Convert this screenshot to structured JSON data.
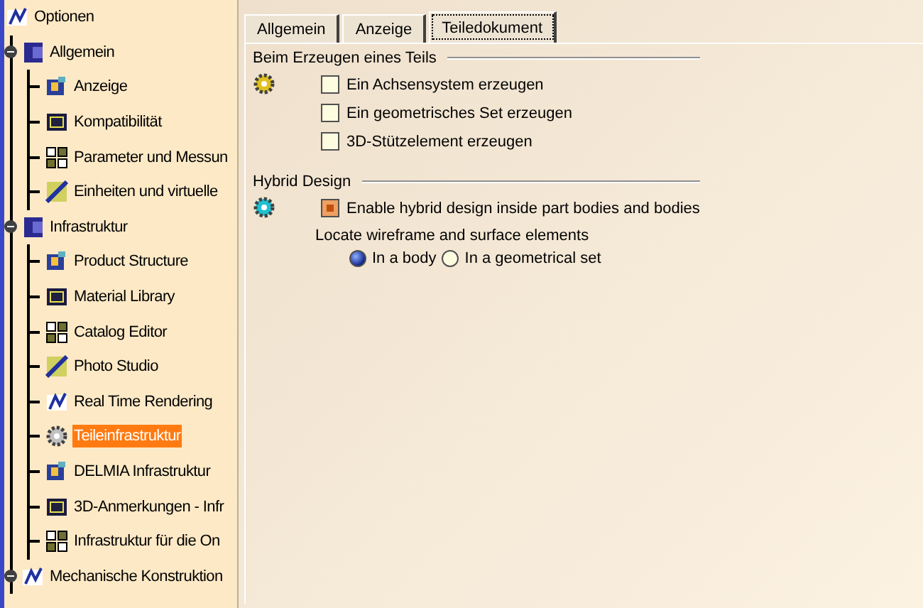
{
  "tree": {
    "label": "Optionen",
    "children": [
      {
        "label": "Allgemein",
        "expanded": true,
        "selected": false,
        "children": [
          {
            "label": "Anzeige",
            "selected": false
          },
          {
            "label": "Kompatibilität",
            "selected": false
          },
          {
            "label": "Parameter und Messun",
            "selected": false
          },
          {
            "label": "Einheiten und virtuelle",
            "selected": false
          }
        ]
      },
      {
        "label": "Infrastruktur",
        "expanded": true,
        "selected": false,
        "children": [
          {
            "label": "Product Structure",
            "selected": false
          },
          {
            "label": "Material Library",
            "selected": false
          },
          {
            "label": "Catalog Editor",
            "selected": false
          },
          {
            "label": "Photo Studio",
            "selected": false
          },
          {
            "label": "Real Time Rendering",
            "selected": false
          },
          {
            "label": "Teileinfrastruktur",
            "selected": true
          },
          {
            "label": "DELMIA Infrastruktur",
            "selected": false
          },
          {
            "label": "3D-Anmerkungen - Infr",
            "selected": false
          },
          {
            "label": "Infrastruktur für die On",
            "selected": false
          }
        ]
      },
      {
        "label": "Mechanische Konstruktion",
        "expanded": true,
        "selected": false
      }
    ]
  },
  "tabs": [
    {
      "label": "Allgemein",
      "selected": false
    },
    {
      "label": "Anzeige",
      "selected": false
    },
    {
      "label": "Teiledokument",
      "selected": true
    }
  ],
  "groups": [
    {
      "title": "Beim Erzeugen eines Teils",
      "options": [
        {
          "kind": "checkbox",
          "label": "Ein Achsensystem erzeugen",
          "checked": false
        },
        {
          "kind": "checkbox",
          "label": "Ein geometrisches Set erzeugen",
          "checked": false
        },
        {
          "kind": "checkbox",
          "label": "3D-Stützelement erzeugen",
          "checked": false
        }
      ]
    },
    {
      "title": "Hybrid Design",
      "options": [
        {
          "kind": "checkbox",
          "label": "Enable hybrid design inside part bodies and bodies",
          "checked": true
        },
        {
          "kind": "text",
          "label": "Locate wireframe and surface elements"
        },
        {
          "kind": "radios",
          "choices": [
            {
              "label": "In a body",
              "selected": true
            },
            {
              "label": "In a geometrical set",
              "selected": false
            }
          ]
        }
      ]
    }
  ]
}
